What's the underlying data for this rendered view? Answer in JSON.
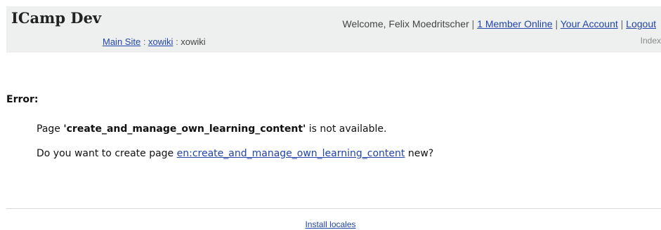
{
  "header": {
    "site_title": "ICamp Dev",
    "breadcrumb": {
      "main_site": "Main Site",
      "sep1": " : ",
      "xowiki_link": "xowiki",
      "sep2": " : ",
      "current": "xowiki"
    },
    "user_bar": {
      "welcome": "Welcome, Felix Moedritscher",
      "sep": " | ",
      "members_online": "1 Member Online",
      "your_account": "Your Account",
      "logout": "Logout"
    },
    "index_link": "Index"
  },
  "error": {
    "label": "Error:",
    "line1_prefix": "Page ",
    "line1_page": "'create_and_manage_own_learning_content'",
    "line1_suffix": " is not available.",
    "line2_prefix": "Do you want to create page ",
    "line2_link": "en:create_and_manage_own_learning_content",
    "line2_suffix": " new?"
  },
  "footer": {
    "install_locales": "Install locales"
  },
  "colors": {
    "header_bg": "#eef0f0",
    "link": "#2244aa"
  }
}
